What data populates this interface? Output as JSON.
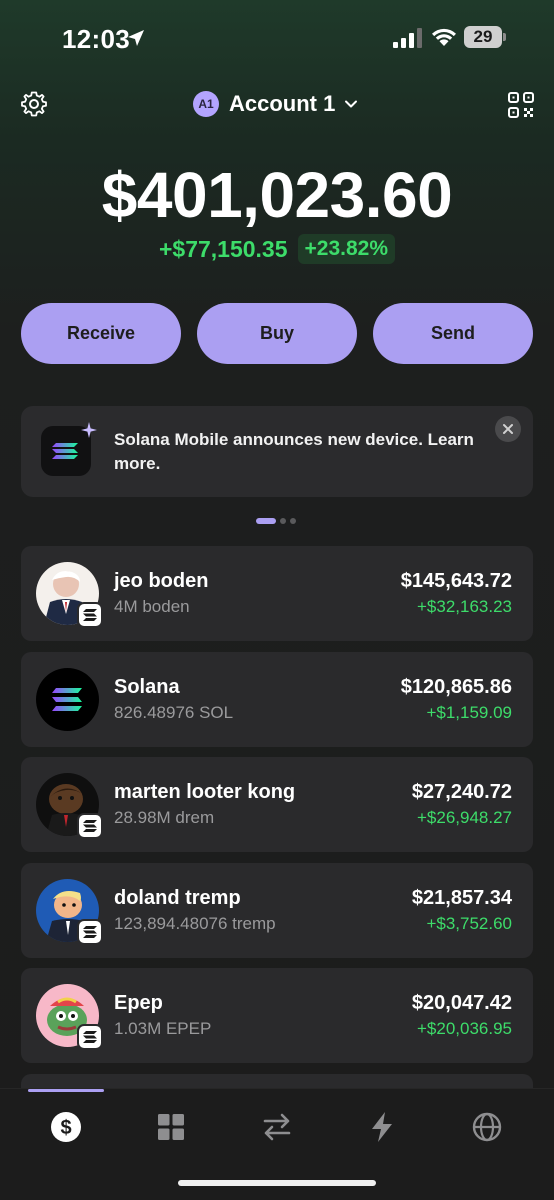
{
  "status_bar": {
    "time": "12:03",
    "battery": "29"
  },
  "header": {
    "account_badge": "A1",
    "account_name": "Account 1"
  },
  "balance": {
    "total": "$401,023.60",
    "change_abs": "+$77,150.35",
    "change_pct": "+23.82%"
  },
  "actions": {
    "receive": "Receive",
    "buy": "Buy",
    "send": "Send"
  },
  "banner": {
    "text": "Solana Mobile announces new device. Learn more."
  },
  "carousel": {
    "count": 3,
    "active": 0
  },
  "tokens": [
    {
      "name": "jeo boden",
      "qty": "4M boden",
      "value": "$145,643.72",
      "change": "+$32,163.23"
    },
    {
      "name": "Solana",
      "qty": "826.48976 SOL",
      "value": "$120,865.86",
      "change": "+$1,159.09"
    },
    {
      "name": "marten looter kong",
      "qty": "28.98M drem",
      "value": "$27,240.72",
      "change": "+$26,948.27"
    },
    {
      "name": "doland tremp",
      "qty": "123,894.48076 tremp",
      "value": "$21,857.34",
      "change": "+$3,752.60"
    },
    {
      "name": "Epep",
      "qty": "1.03M EPEP",
      "value": "$20,047.42",
      "change": "+$20,036.95"
    }
  ],
  "nav": [
    "dollar-icon",
    "grid-icon",
    "swap-icon",
    "lightning-icon",
    "globe-icon"
  ],
  "colors": {
    "accent": "#ab9ff2",
    "positive": "#3ddc6a",
    "card": "#2a2a2c",
    "background": "#1c1c1c"
  }
}
